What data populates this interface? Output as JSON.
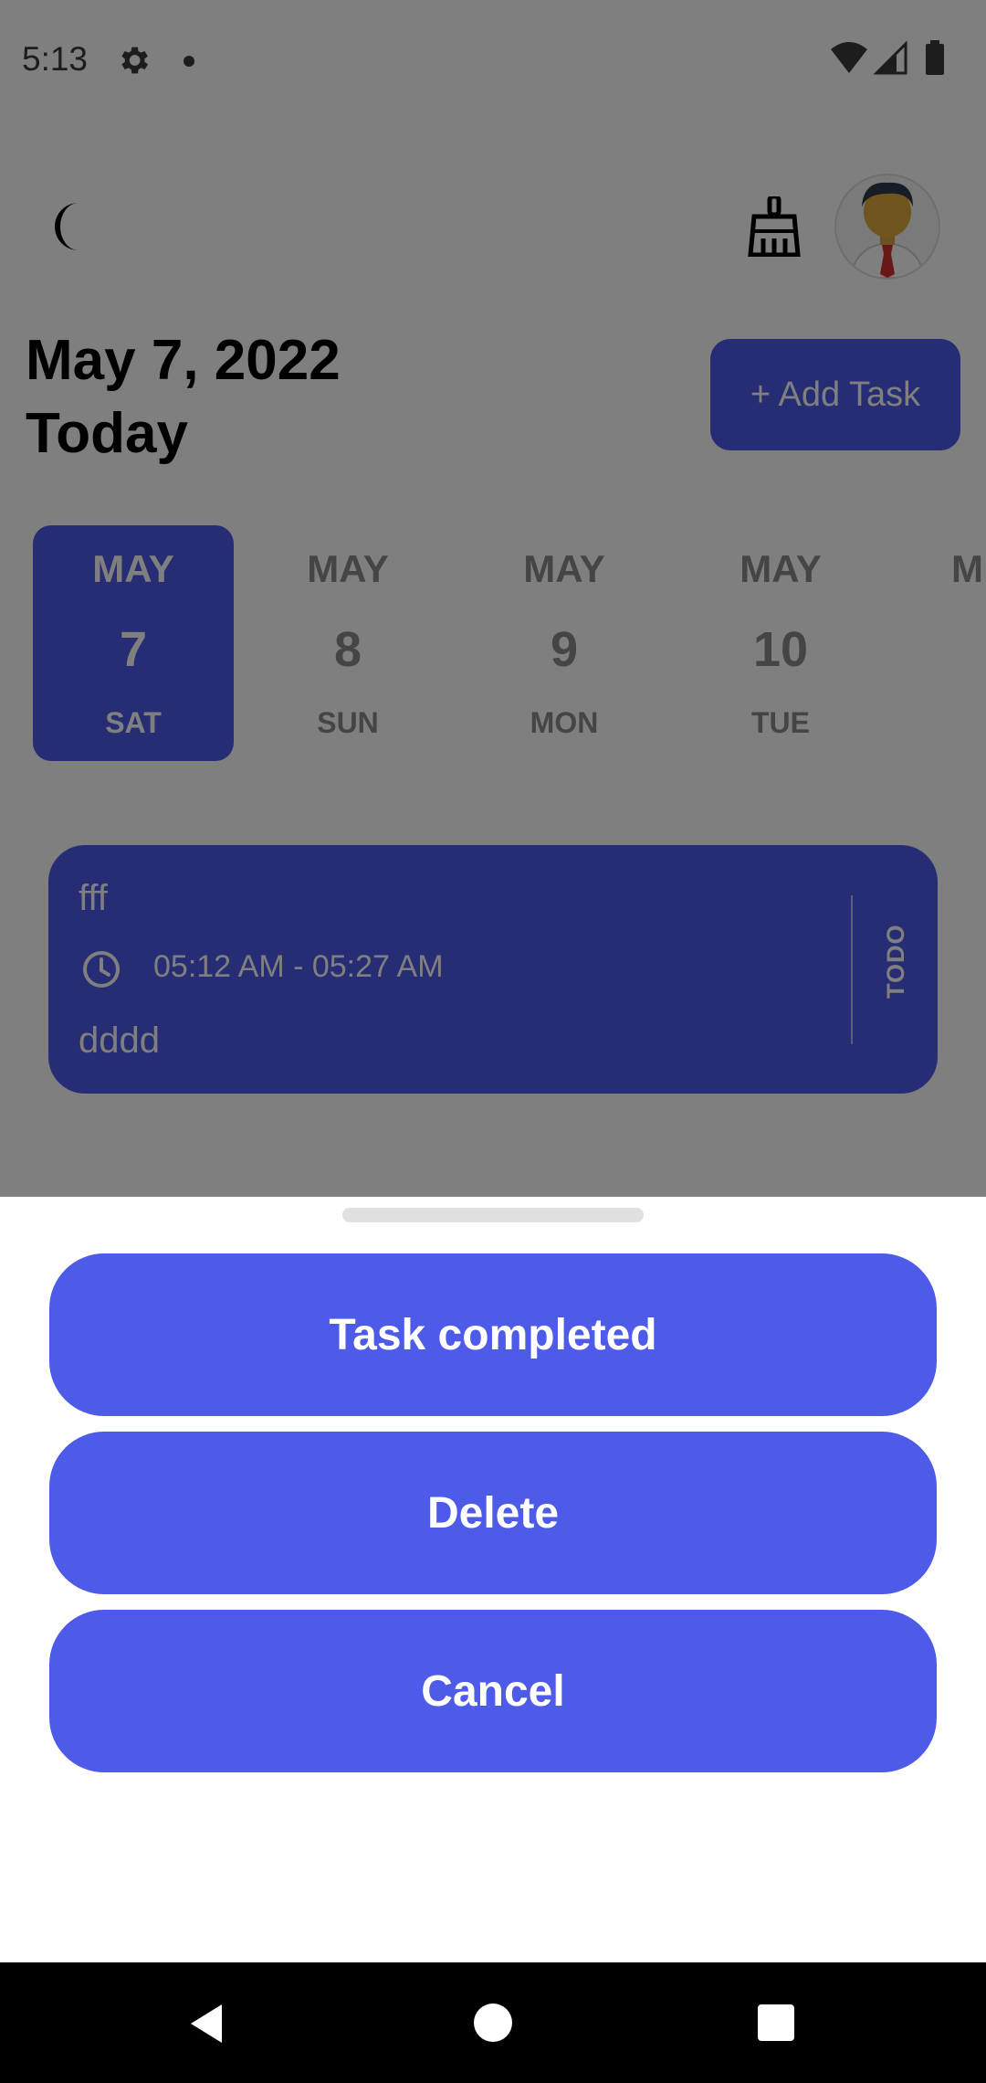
{
  "status_bar": {
    "time": "5:13"
  },
  "header": {
    "date": "May 7, 2022",
    "today": "Today",
    "add_task_label": "+ Add Task"
  },
  "days": [
    {
      "month": "MAY",
      "day": "7",
      "weekday": "SAT",
      "selected": true
    },
    {
      "month": "MAY",
      "day": "8",
      "weekday": "SUN",
      "selected": false
    },
    {
      "month": "MAY",
      "day": "9",
      "weekday": "MON",
      "selected": false
    },
    {
      "month": "MAY",
      "day": "10",
      "weekday": "TUE",
      "selected": false
    },
    {
      "month": "M",
      "day": "",
      "weekday": "",
      "selected": false
    }
  ],
  "task": {
    "title": "fff",
    "time": "05:12 AM - 05:27 AM",
    "description": "dddd",
    "status": "TODO"
  },
  "sheet": {
    "complete_label": "Task completed",
    "delete_label": "Delete",
    "cancel_label": "Cancel"
  },
  "colors": {
    "accent": "#4e5ae8",
    "scrim": "rgba(0,0,0,0.5)"
  },
  "icons": {
    "theme_toggle": "moon-icon",
    "clear": "broom-icon",
    "time": "clock-icon",
    "settings": "gear-icon"
  }
}
